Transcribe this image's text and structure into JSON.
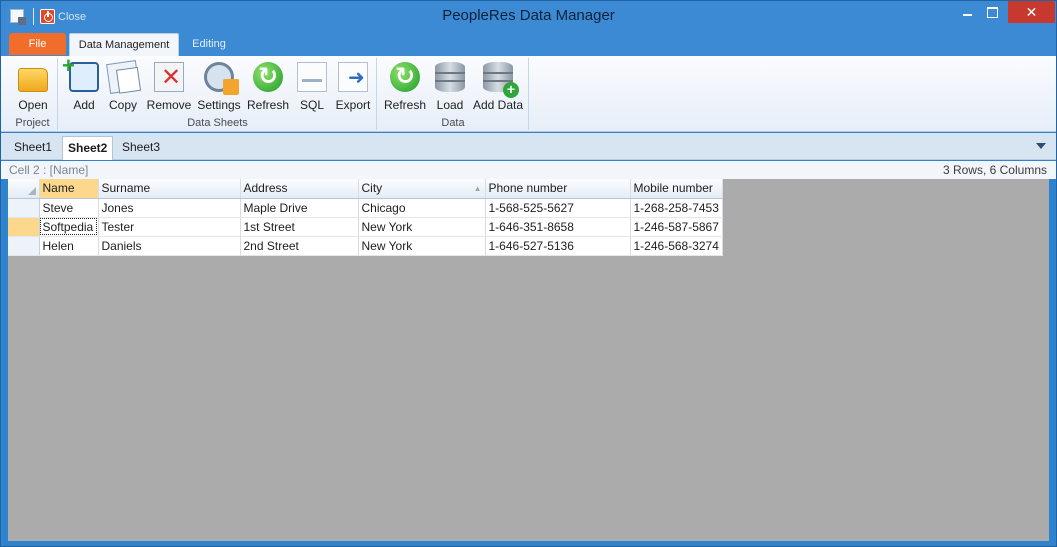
{
  "window": {
    "title": "PeopleRes Data Manager",
    "close_label": "Close",
    "close_symbol": "✕"
  },
  "ribbon": {
    "file_tab": "File",
    "tabs": [
      "Data Management",
      "Editing"
    ],
    "groups": {
      "project": {
        "label": "Project",
        "buttons": [
          "Open"
        ]
      },
      "data_sheets": {
        "label": "Data Sheets",
        "buttons": [
          "Add",
          "Copy",
          "Remove",
          "Settings",
          "Refresh",
          "SQL",
          "Export"
        ]
      },
      "data": {
        "label": "Data",
        "buttons": [
          "Refresh",
          "Load",
          "Add Data"
        ]
      }
    }
  },
  "sheets": [
    "Sheet1",
    "Sheet2",
    "Sheet3"
  ],
  "status": {
    "cell_ref": "Cell 2 : [Name]",
    "summary": "3 Rows, 6 Columns"
  },
  "grid": {
    "columns": [
      "Name",
      "Surname",
      "Address",
      "City",
      "Phone number",
      "Mobile number"
    ],
    "rows": [
      [
        "Steve",
        "Jones",
        "Maple Drive",
        "Chicago",
        "1-568-525-5627",
        "1-268-258-7453"
      ],
      [
        "Softpedia",
        "Tester",
        "1st Street",
        "New York",
        "1-646-351-8658",
        "1-246-587-5867"
      ],
      [
        "Helen",
        "Daniels",
        "2nd Street",
        "New York",
        "1-646-527-5136",
        "1-246-568-3274"
      ]
    ],
    "sorted_column": "City",
    "selected_row": 1,
    "selected_column": "Name"
  },
  "colors": {
    "accent": "#3c8ad3",
    "file_tab": "#f06d2b",
    "selection": "#fbd88b",
    "grid_background": "#ababab"
  }
}
